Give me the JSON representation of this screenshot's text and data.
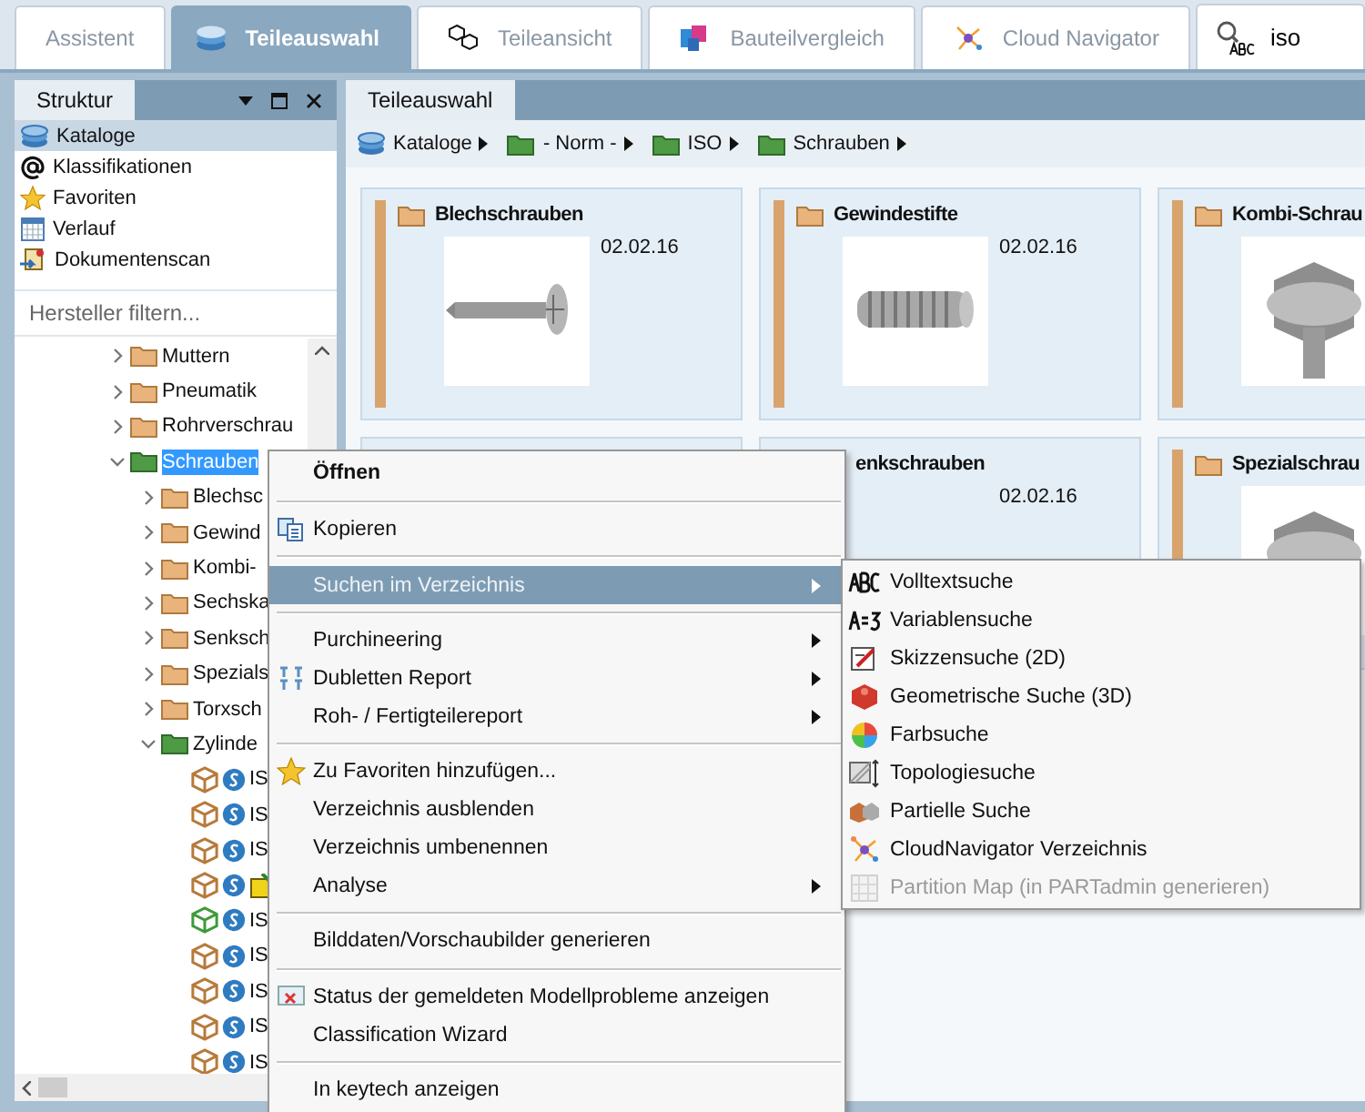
{
  "top_tabs": [
    {
      "label": "Assistent",
      "selected": false
    },
    {
      "label": "Teileauswahl",
      "selected": true
    },
    {
      "label": "Teileansicht",
      "selected": false
    },
    {
      "label": "Bauteilvergleich",
      "selected": false
    },
    {
      "label": "Cloud Navigator",
      "selected": false
    }
  ],
  "top_search": {
    "value": "iso"
  },
  "left_panel": {
    "tab": "Struktur",
    "nav": [
      {
        "label": "Kataloge",
        "selected": true
      },
      {
        "label": "Klassifikationen",
        "selected": false
      },
      {
        "label": "Favoriten",
        "selected": false
      },
      {
        "label": "Verlauf",
        "selected": false
      },
      {
        "label": "Dokumentenscan",
        "selected": false
      }
    ],
    "filter": {
      "placeholder": "Hersteller filtern..."
    },
    "tree": [
      {
        "kind": "folder",
        "label": "Muttern",
        "expanded": false,
        "selected": false
      },
      {
        "kind": "folder",
        "label": "Pneumatik",
        "expanded": false,
        "selected": false
      },
      {
        "kind": "folder",
        "label": "Rohrverschrau",
        "expanded": false,
        "selected": false
      },
      {
        "kind": "catalog",
        "label": "Schrauben",
        "expanded": true,
        "selected": true,
        "children": [
          {
            "kind": "folder",
            "label": "Blechsc",
            "expanded": false,
            "selected": false
          },
          {
            "kind": "folder",
            "label": "Gewind",
            "expanded": false,
            "selected": false
          },
          {
            "kind": "folder",
            "label": "Kombi-",
            "expanded": false,
            "selected": false
          },
          {
            "kind": "folder",
            "label": "Sechska",
            "expanded": false,
            "selected": false
          },
          {
            "kind": "folder",
            "label": "Senksch",
            "expanded": false,
            "selected": false
          },
          {
            "kind": "folder",
            "label": "Spezials",
            "expanded": false,
            "selected": false
          },
          {
            "kind": "folder",
            "label": "Torxsch",
            "expanded": false,
            "selected": false
          },
          {
            "kind": "catalog",
            "label": "Zylinde",
            "expanded": true,
            "selected": false,
            "children": [
              {
                "kind": "part",
                "label": "IS",
                "color": "#b77a3a",
                "selected": false
              },
              {
                "kind": "part",
                "label": "IS",
                "color": "#b77a3a",
                "selected": false
              },
              {
                "kind": "part",
                "label": "IS",
                "color": "#b77a3a",
                "selected": false
              },
              {
                "kind": "part-note",
                "color": "#b77a3a",
                "selected": false
              },
              {
                "kind": "part",
                "label": "IS",
                "color": "#3f9a3a",
                "selected": false
              },
              {
                "kind": "part",
                "label": "IS",
                "color": "#b77a3a",
                "selected": false
              },
              {
                "kind": "part",
                "label": "IS",
                "color": "#b77a3a",
                "selected": false
              },
              {
                "kind": "part",
                "label": "IS",
                "color": "#b77a3a",
                "selected": false
              },
              {
                "kind": "part",
                "label": "IS",
                "color": "#b77a3a",
                "selected": false
              }
            ]
          }
        ]
      }
    ]
  },
  "content": {
    "tab": "Teileauswahl",
    "breadcrumb": [
      {
        "kind": "catalogs",
        "label": "Kataloge"
      },
      {
        "kind": "folder",
        "label": "- Norm -"
      },
      {
        "kind": "folder",
        "label": "ISO"
      },
      {
        "kind": "folder",
        "label": "Schrauben"
      }
    ],
    "cards": [
      {
        "kind": "full",
        "title": "Blechschrauben",
        "date": "02.02.16"
      },
      {
        "kind": "full",
        "title": "Gewindestifte",
        "date": "02.02.16"
      },
      {
        "kind": "full",
        "title": "Kombi-Schrau"
      },
      {
        "kind": "covered"
      },
      {
        "kind": "partial",
        "title": "enkschrauben",
        "date": "02.02.16"
      },
      {
        "kind": "full",
        "title": "Spezialschrau"
      }
    ]
  },
  "context_menu": [
    {
      "kind": "item",
      "label": "Öffnen",
      "bold": true,
      "submenu": false,
      "selected": false
    },
    {
      "kind": "separator"
    },
    {
      "kind": "item",
      "label": "Kopieren",
      "bold": false,
      "submenu": false,
      "selected": false
    },
    {
      "kind": "separator"
    },
    {
      "kind": "item",
      "label": "Suchen im Verzeichnis",
      "bold": false,
      "submenu": true,
      "selected": true
    },
    {
      "kind": "separator"
    },
    {
      "kind": "item",
      "label": "Purchineering",
      "bold": false,
      "submenu": true,
      "selected": false
    },
    {
      "kind": "item",
      "label": "Dubletten Report",
      "bold": false,
      "submenu": true,
      "selected": false
    },
    {
      "kind": "item",
      "label": "Roh- / Fertigteilereport",
      "bold": false,
      "submenu": true,
      "selected": false
    },
    {
      "kind": "separator"
    },
    {
      "kind": "item",
      "label": "Zu Favoriten hinzufügen...",
      "bold": false,
      "submenu": false,
      "selected": false
    },
    {
      "kind": "item",
      "label": "Verzeichnis ausblenden",
      "bold": false,
      "submenu": false,
      "selected": false
    },
    {
      "kind": "item",
      "label": "Verzeichnis umbenennen",
      "bold": false,
      "submenu": false,
      "selected": false
    },
    {
      "kind": "item",
      "label": "Analyse",
      "bold": false,
      "submenu": true,
      "selected": false
    },
    {
      "kind": "separator"
    },
    {
      "kind": "item",
      "label": "Bilddaten/Vorschaubilder generieren",
      "bold": false,
      "submenu": false,
      "selected": false
    },
    {
      "kind": "separator"
    },
    {
      "kind": "item",
      "label": "Status der gemeldeten Modellprobleme anzeigen",
      "bold": false,
      "submenu": false,
      "selected": false
    },
    {
      "kind": "item",
      "label": "Classification Wizard",
      "bold": false,
      "submenu": false,
      "selected": false
    },
    {
      "kind": "separator"
    },
    {
      "kind": "item",
      "label": "In keytech anzeigen",
      "bold": false,
      "submenu": false,
      "selected": false
    }
  ],
  "submenu": [
    {
      "label": "Volltextsuche",
      "disabled": false
    },
    {
      "label": "Variablensuche",
      "disabled": false
    },
    {
      "label": "Skizzensuche (2D)",
      "disabled": false
    },
    {
      "label": "Geometrische Suche (3D)",
      "disabled": false
    },
    {
      "label": "Farbsuche",
      "disabled": false
    },
    {
      "label": "Topologiesuche",
      "disabled": false
    },
    {
      "label": "Partielle Suche",
      "disabled": false
    },
    {
      "label": "CloudNavigator Verzeichnis",
      "disabled": false
    },
    {
      "label": "Partition Map (in PARTadmin generieren)",
      "disabled": true
    }
  ]
}
